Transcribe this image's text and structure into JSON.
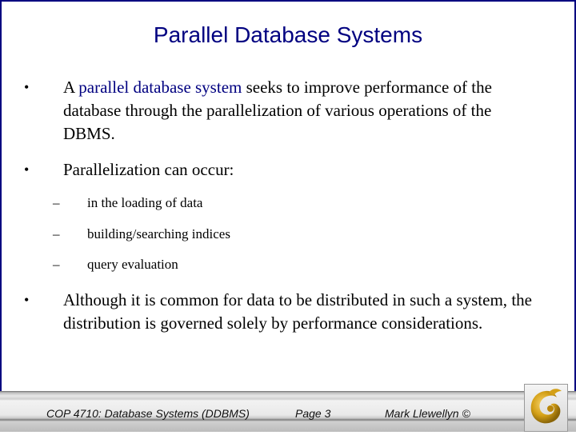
{
  "slide": {
    "title": "Parallel Database Systems",
    "bullets": [
      {
        "marker": "•",
        "highlight": "parallel database system",
        "prefix": "A ",
        "suffix": " seeks to improve performance of the database through the parallelization of various operations of the DBMS."
      },
      {
        "marker": "•",
        "text": "Parallelization can occur:",
        "subitems": [
          {
            "marker": "–",
            "text": "in the loading of data"
          },
          {
            "marker": "–",
            "text": "building/searching indices"
          },
          {
            "marker": "–",
            "text": "query evaluation"
          }
        ]
      },
      {
        "marker": "•",
        "text": "Although it is common for data to be distributed in such a system, the distribution is governed solely by performance considerations."
      }
    ]
  },
  "footer": {
    "course": "COP 4710: Database Systems  (DDBMS)",
    "page": "Page 3",
    "author": "Mark Llewellyn ©",
    "logo": "ucf-pegasus-logo-icon"
  },
  "colors": {
    "title": "#000080",
    "border": "#000080",
    "logo_gold": "#d4a017"
  }
}
